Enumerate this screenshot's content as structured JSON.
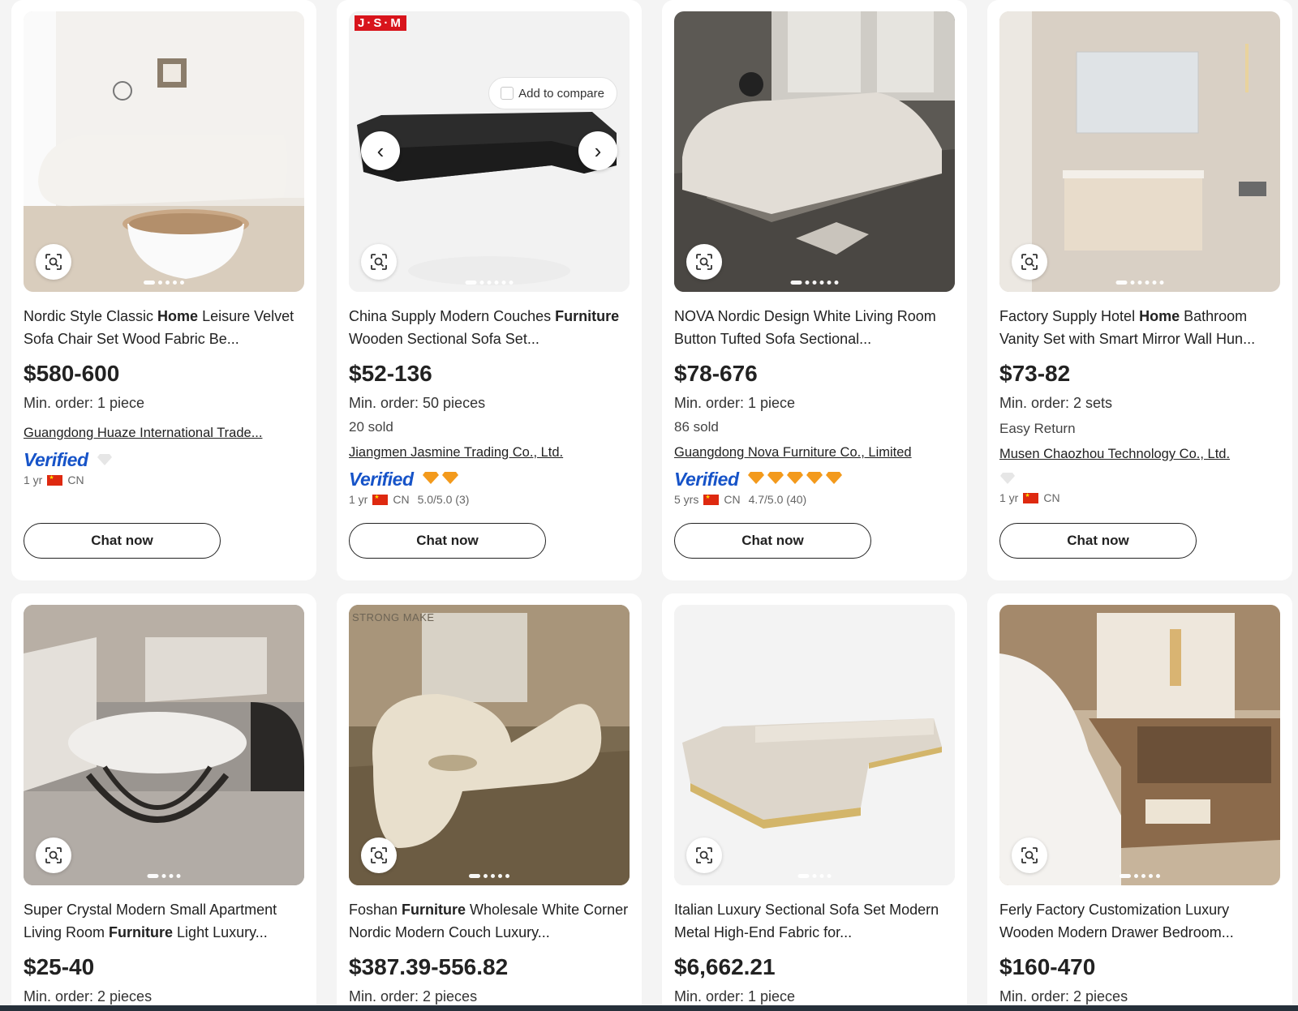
{
  "products": [
    {
      "title_parts": [
        "Nordic Style Classic ",
        "Home",
        " Leisure Velvet Sofa Chair Set Wood Fabric Be..."
      ],
      "price": "$580-600",
      "moq": "Min. order: 1 piece",
      "sold": "",
      "extra": "",
      "supplier": "Guangdong Huaze International Trade...",
      "verified": "Verified",
      "diamonds": 0,
      "meta_years": "1 yr",
      "meta_country": "CN",
      "meta_rating": "",
      "chat": "Chat now"
    },
    {
      "title_parts": [
        "China Supply Modern Couches ",
        "Furniture",
        " Wooden Sectional Sofa Set..."
      ],
      "price": "$52-136",
      "moq": "Min. order: 50 pieces",
      "sold": "20 sold",
      "extra": "",
      "supplier": "Jiangmen Jasmine Trading Co., Ltd.",
      "verified": "Verified",
      "diamonds": 2,
      "meta_years": "1 yr",
      "meta_country": "CN",
      "meta_rating": "5.0/5.0 (3)",
      "compare_label": "Add to compare",
      "brand_mark": "J·S·M",
      "chat": "Chat now"
    },
    {
      "title_parts": [
        "NOVA Nordic Design White Living Room Button Tufted Sofa Sectional...",
        "",
        ""
      ],
      "price": "$78-676",
      "moq": "Min. order: 1 piece",
      "sold": "86 sold",
      "extra": "",
      "supplier": "Guangdong Nova Furniture Co., Limited",
      "verified": "Verified",
      "diamonds": 5,
      "meta_years": "5 yrs",
      "meta_country": "CN",
      "meta_rating": "4.7/5.0 (40)",
      "chat": "Chat now"
    },
    {
      "title_parts": [
        "Factory Supply Hotel ",
        "Home",
        " Bathroom Vanity Set with Smart Mirror Wall Hun..."
      ],
      "price": "$73-82",
      "moq": "Min. order: 2 sets",
      "sold": "",
      "extra": "Easy Return",
      "supplier": "Musen Chaozhou Technology Co., Ltd.",
      "verified": "",
      "diamonds": 0,
      "meta_years": "1 yr",
      "meta_country": "CN",
      "meta_rating": "",
      "chat": "Chat now"
    },
    {
      "title_parts": [
        "Super Crystal Modern Small Apartment Living Room ",
        "Furniture",
        " Light Luxury..."
      ],
      "price": "$25-40",
      "moq": "Min. order: 2 pieces"
    },
    {
      "title_parts": [
        "Foshan ",
        "Furniture",
        " Wholesale White Corner Nordic Modern Couch Luxury..."
      ],
      "price": "$387.39-556.82",
      "moq": "Min. order: 2 pieces",
      "brand_mark": "STRONG MAKE"
    },
    {
      "title_parts": [
        "Italian Luxury Sectional Sofa Set Modern Metal High-End Fabric for...",
        "",
        ""
      ],
      "price": "$6,662.21",
      "moq": "Min. order: 1 piece"
    },
    {
      "title_parts": [
        "Ferly Factory Customization Luxury Wooden Modern Drawer Bedroom...",
        "",
        ""
      ],
      "price": "$160-470",
      "moq": "Min. order: 2 pieces"
    }
  ],
  "icons": {
    "image_search": "image-search-icon",
    "prev": "chevron-left-icon",
    "next": "chevron-right-icon",
    "diamond": "gold-diamond-icon",
    "flag": "cn-flag-icon"
  },
  "colors": {
    "verified": "#1653c8",
    "diamond": "#f39a1c",
    "price": "#222222"
  }
}
